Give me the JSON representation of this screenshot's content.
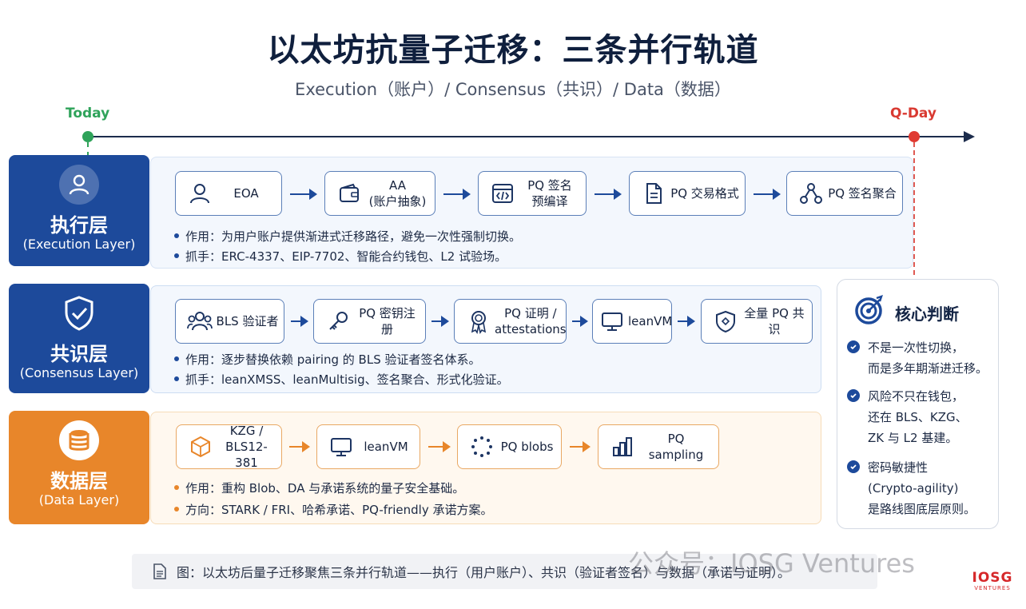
{
  "title": "以太坊抗量子迁移：三条并行轨道",
  "subtitle": "Execution（账户）/ Consensus（共识）/ Data（数据）",
  "timeline": {
    "start_label": "Today",
    "end_label": "Q-Day"
  },
  "layers": {
    "execution": {
      "name": "执行层",
      "sub": "(Execution Layer)",
      "steps": [
        "EOA",
        "AA\n(账户抽象)",
        "PQ 签名\n预编译",
        "PQ 交易格式",
        "PQ 签名聚合"
      ],
      "bullet1": "作用：为用户账户提供渐进式迁移路径，避免一次性强制切换。",
      "bullet2": "抓手：ERC-4337、EIP-7702、智能合约钱包、L2 试验场。"
    },
    "consensus": {
      "name": "共识层",
      "sub": "(Consensus Layer)",
      "steps": [
        "BLS 验证者",
        "PQ 密钥注册",
        "PQ 证明 /\nattestations",
        "leanVM",
        "全量 PQ 共识"
      ],
      "bullet1": "作用：逐步替换依赖 pairing 的 BLS 验证者签名体系。",
      "bullet2": "抓手：leanXMSS、leanMultisig、签名聚合、形式化验证。"
    },
    "data": {
      "name": "数据层",
      "sub": "(Data Layer)",
      "steps": [
        "KZG /\nBLS12-381",
        "leanVM",
        "PQ blobs",
        "PQ sampling"
      ],
      "bullet1": "作用：重构 Blob、DA 与承诺系统的量子安全基础。",
      "bullet2": "方向：STARK / FRI、哈希承诺、PQ-friendly 承诺方案。"
    }
  },
  "judgment": {
    "title": "核心判断",
    "items": [
      "不是一次性切换，\n而是多年期渐进迁移。",
      "风险不只在钱包，\n还在 BLS、KZG、\nZK 与 L2 基建。",
      "密码敏捷性\n(Crypto-agility)\n是路线图底层原则。"
    ]
  },
  "caption": "图：以太坊后量子迁移聚焦三条并行轨道——执行（用户账户）、共识（验证者签名）与数据（承诺与证明）。",
  "watermark": "公众号：IOSG Ventures",
  "logo": {
    "main": "IOSG",
    "sub": "VENTURES"
  },
  "colors": {
    "blue": "#1d4a9b",
    "orange": "#e8862a",
    "today": "#2fa35a",
    "qday": "#e03a32"
  },
  "icons": {
    "execution": [
      "user-icon",
      "wallet-icon",
      "code-icon",
      "document-icon",
      "network-icon"
    ],
    "consensus": [
      "people-icon",
      "key-icon",
      "badge-icon",
      "monitor-icon",
      "shield-icon"
    ],
    "data": [
      "cube-icon",
      "monitor-icon",
      "dots-circle-icon",
      "bar-chart-icon"
    ]
  }
}
